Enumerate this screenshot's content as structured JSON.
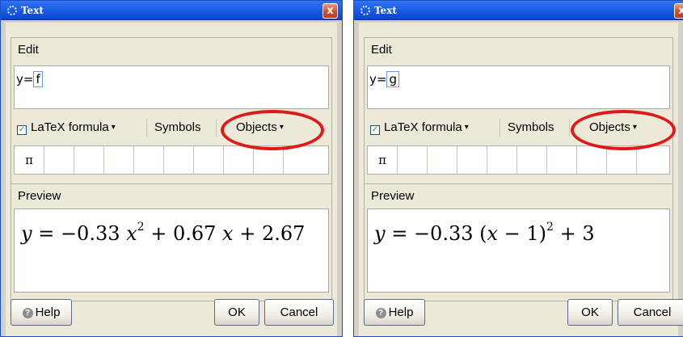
{
  "left_dialog": {
    "title": "Text",
    "close_glyph": "x",
    "edit_label": "Edit",
    "input_prefix": "y=",
    "input_object": "f",
    "latex_label": "LaTeX formula",
    "latex_checked": true,
    "symbols_label": "Symbols",
    "objects_label": "Objects",
    "symbol_first": "π",
    "preview_label": "Preview",
    "formula": {
      "lhs": "y",
      "op": " = ",
      "a": "−0.33 ",
      "var1": "x",
      "exp": "2",
      "rest1": " + 0.67 ",
      "var2": "x",
      "rest2": " + 2.67"
    },
    "help_label": "Help",
    "ok_label": "OK",
    "cancel_label": "Cancel"
  },
  "right_dialog": {
    "title": "Text",
    "close_glyph": "x",
    "edit_label": "Edit",
    "input_prefix": "y=",
    "input_object": "g",
    "latex_label": "LaTeX formula",
    "latex_checked": true,
    "symbols_label": "Symbols",
    "objects_label": "Objects",
    "symbol_first": "π",
    "preview_label": "Preview",
    "formula": {
      "lhs": "y",
      "op": " = ",
      "a": "−0.33  (",
      "var1": "x",
      "mid": " − 1)",
      "exp": "2",
      "rest": " + 3"
    },
    "help_label": "Help",
    "ok_label": "OK",
    "cancel_label": "Cancel"
  },
  "colors": {
    "titlebar": "#1c5ee6",
    "dialog_bg": "#ece9d8",
    "highlight_ring": "#e01818"
  },
  "icons": [
    "gear-icon",
    "close-icon",
    "checkbox-checked-icon",
    "help-icon",
    "dropdown-arrow-icon"
  ]
}
